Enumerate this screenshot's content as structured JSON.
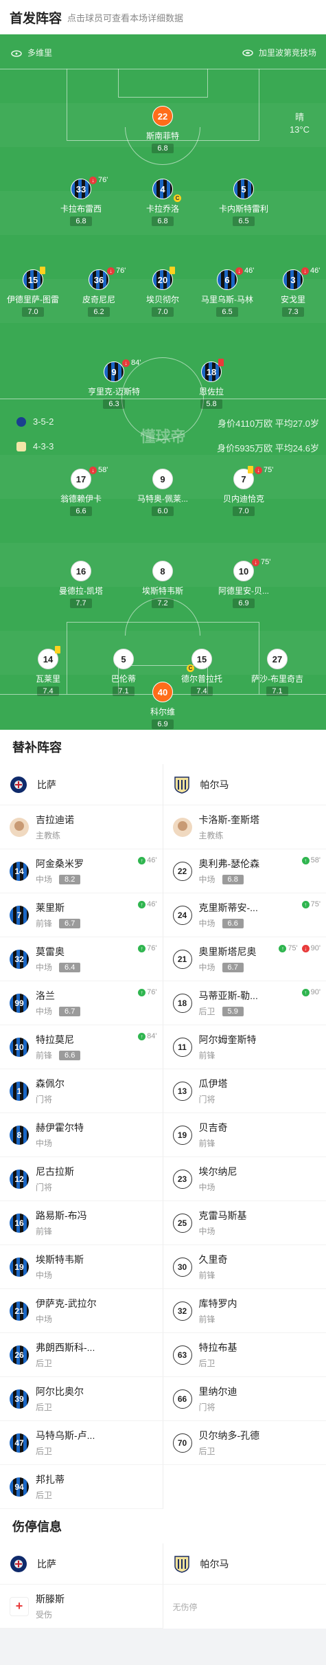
{
  "header": {
    "title": "首发阵容",
    "subtitle": "点击球员可查看本场详细数据"
  },
  "pitch": {
    "home_team": "多维里",
    "away_team": "加里波第竞技场",
    "weather": "晴",
    "temperature": "13°C",
    "watermark": "懂球帝",
    "home_formation": "3-5-2",
    "home_value": "身价4110万欧 平均27.0岁",
    "away_formation": "4-3-3",
    "away_value": "身价5935万欧 平均24.6岁",
    "home_players": [
      {
        "num": "22",
        "name": "斯南菲特",
        "rate": "6.8"
      },
      {
        "num": "33",
        "name": "卡拉布雷西",
        "rate": "6.8",
        "event": "76'"
      },
      {
        "num": "4",
        "name": "卡拉乔洛",
        "rate": "6.8"
      },
      {
        "num": "5",
        "name": "卡内斯特雷利",
        "rate": "6.5"
      },
      {
        "num": "15",
        "name": "伊德里萨-图雷",
        "rate": "7.0"
      },
      {
        "num": "36",
        "name": "皮奇尼尼",
        "rate": "6.2",
        "event": "76'"
      },
      {
        "num": "20",
        "name": "埃贝彻尔",
        "rate": "7.0"
      },
      {
        "num": "6",
        "name": "马里乌斯-马林",
        "rate": "6.5",
        "event": "46'"
      },
      {
        "num": "3",
        "name": "安戈里",
        "rate": "7.3",
        "event": "46'"
      },
      {
        "num": "9",
        "name": "亨里克-迈斯特",
        "rate": "6.3",
        "event": "84'"
      },
      {
        "num": "18",
        "name": "恩佐拉",
        "rate": "5.8"
      }
    ],
    "away_players": [
      {
        "num": "17",
        "name": "翁德赖伊卡",
        "rate": "6.6",
        "event": "58'"
      },
      {
        "num": "9",
        "name": "马特奥-佩莱...",
        "rate": "6.0"
      },
      {
        "num": "7",
        "name": "贝内迪恰克",
        "rate": "7.0",
        "event": "75'"
      },
      {
        "num": "16",
        "name": "曼德拉-凯塔",
        "rate": "7.7"
      },
      {
        "num": "8",
        "name": "埃斯特韦斯",
        "rate": "7.2"
      },
      {
        "num": "10",
        "name": "阿德里安-贝...",
        "rate": "6.9",
        "event": "75'"
      },
      {
        "num": "14",
        "name": "瓦莱里",
        "rate": "7.4"
      },
      {
        "num": "5",
        "name": "巴伦蒂",
        "rate": "7.1"
      },
      {
        "num": "15",
        "name": "德尔普拉托",
        "rate": "7.4"
      },
      {
        "num": "27",
        "name": "萨沙-布里奇吉",
        "rate": "7.1"
      },
      {
        "num": "40",
        "name": "科尔维",
        "rate": "6.9"
      }
    ]
  },
  "subs": {
    "title": "替补阵容",
    "home_team": "比萨",
    "away_team": "帕尔马",
    "home_coach": {
      "name": "吉拉迪诺",
      "role": "主教练"
    },
    "away_coach": {
      "name": "卡洛斯-奎斯塔",
      "role": "主教练"
    },
    "home": [
      {
        "num": "14",
        "name": "阿金桑米罗",
        "pos": "中场",
        "rate": "8.2",
        "event": "46'"
      },
      {
        "num": "7",
        "name": "莱里斯",
        "pos": "前锋",
        "rate": "6.7",
        "event": "46'"
      },
      {
        "num": "32",
        "name": "莫雷奥",
        "pos": "中场",
        "rate": "6.4",
        "event": "76'"
      },
      {
        "num": "99",
        "name": "洛兰",
        "pos": "中场",
        "rate": "6.7",
        "event": "76'"
      },
      {
        "num": "10",
        "name": "特拉莫尼",
        "pos": "前锋",
        "rate": "6.6",
        "event": "84'"
      },
      {
        "num": "1",
        "name": "森佩尔",
        "pos": "门将"
      },
      {
        "num": "8",
        "name": "赫伊霍尔特",
        "pos": "中场"
      },
      {
        "num": "12",
        "name": "尼古拉斯",
        "pos": "门将"
      },
      {
        "num": "16",
        "name": "路易斯-布冯",
        "pos": "前锋"
      },
      {
        "num": "19",
        "name": "埃斯特韦斯",
        "pos": "中场"
      },
      {
        "num": "21",
        "name": "伊萨克-武拉尔",
        "pos": "中场"
      },
      {
        "num": "26",
        "name": "弗朗西斯科-...",
        "pos": "后卫"
      },
      {
        "num": "39",
        "name": "阿尔比奥尔",
        "pos": "后卫"
      },
      {
        "num": "47",
        "name": "马特乌斯-卢...",
        "pos": "后卫"
      },
      {
        "num": "94",
        "name": "邦扎蒂",
        "pos": "后卫"
      }
    ],
    "away": [
      {
        "num": "22",
        "name": "奥利弗-瑟伦森",
        "pos": "中场",
        "rate": "6.8",
        "event": "58'"
      },
      {
        "num": "24",
        "name": "克里斯蒂安-...",
        "pos": "中场",
        "rate": "6.6",
        "event": "75'"
      },
      {
        "num": "21",
        "name": "奥里斯塔尼奥",
        "pos": "中场",
        "rate": "6.7",
        "event": "75'",
        "event2": "90'"
      },
      {
        "num": "18",
        "name": "马蒂亚斯-勒...",
        "pos": "后卫",
        "rate": "5.9",
        "event": "90'"
      },
      {
        "num": "11",
        "name": "阿尔姆奎斯特",
        "pos": "前锋"
      },
      {
        "num": "13",
        "name": "瓜伊塔",
        "pos": "门将"
      },
      {
        "num": "19",
        "name": "贝吉奇",
        "pos": "前锋"
      },
      {
        "num": "23",
        "name": "埃尔纳尼",
        "pos": "中场"
      },
      {
        "num": "25",
        "name": "克雷马斯基",
        "pos": "中场"
      },
      {
        "num": "30",
        "name": "久里奇",
        "pos": "前锋"
      },
      {
        "num": "32",
        "name": "库特罗内",
        "pos": "前锋"
      },
      {
        "num": "63",
        "name": "特拉布基",
        "pos": "后卫"
      },
      {
        "num": "66",
        "name": "里纳尔迪",
        "pos": "门将"
      },
      {
        "num": "70",
        "name": "贝尔纳多-孔德",
        "pos": "后卫"
      }
    ]
  },
  "injury": {
    "title": "伤停信息",
    "home_team": "比萨",
    "away_team": "帕尔马",
    "home_player": {
      "name": "斯滕斯",
      "status": "受伤"
    },
    "away_none": "无伤停"
  },
  "colors": {
    "pitch": "#3aa953",
    "inter_blue": "#1a66c4",
    "keeper": "#ff6d1a",
    "sub_in": "#2fb54f",
    "sub_out": "#e83b3b"
  }
}
